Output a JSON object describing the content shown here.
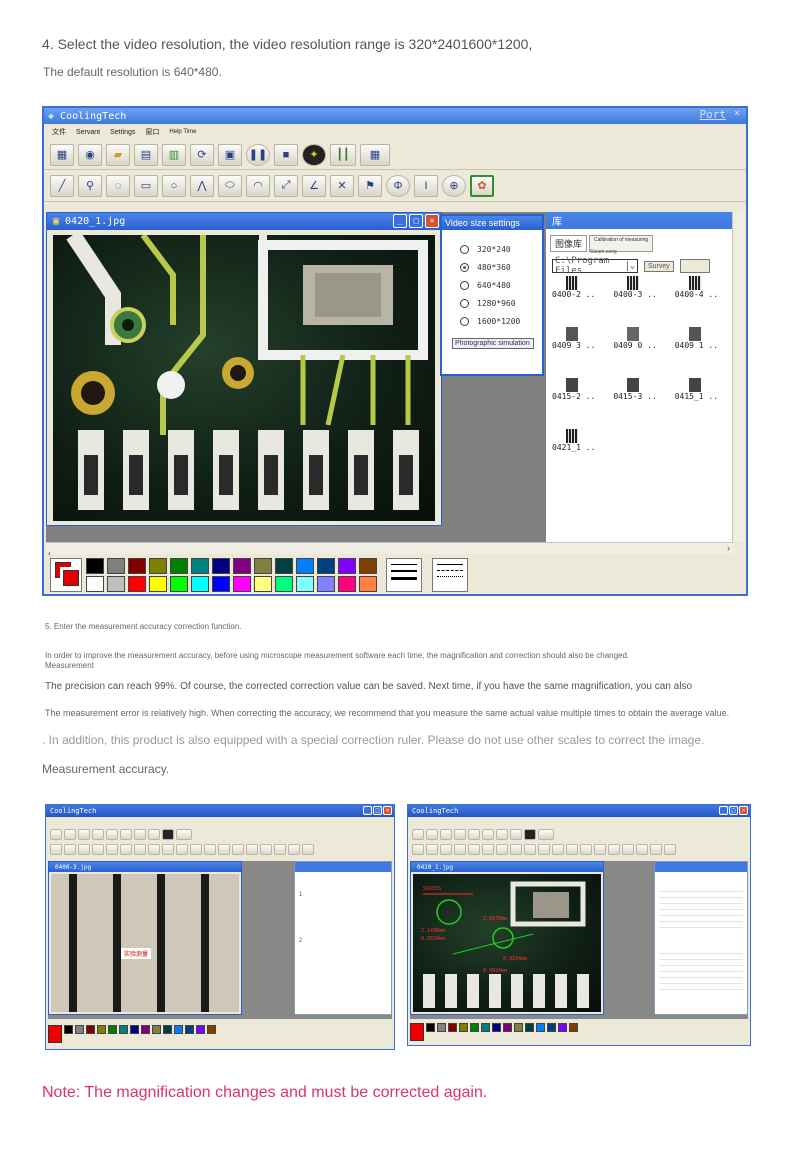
{
  "step4": {
    "title": "4. Select the video resolution, the video resolution range is 320*2401600*1200,",
    "subtitle": "The default resolution is 640*480."
  },
  "app": {
    "title": "CoolingTech",
    "port_label": "Port",
    "menu": [
      "文件",
      "Servant",
      "Settings",
      "窗口",
      "Help Time"
    ],
    "image_window_title": "0420_1.jpg",
    "library_title": "库",
    "library_tabs": [
      "图像库",
      "Calibration of measuring",
      "Steam song"
    ],
    "path_value": "C:\\Program Files",
    "survey_button": "Survey",
    "thumbnails": [
      [
        "0400-2 ..",
        "0400-3 ..",
        "0400-4 .."
      ],
      [
        "0409 3 ..",
        "0409 0 ..",
        "0409 1 .."
      ],
      [
        "0415-2 ..",
        "0415-3 ..",
        "0415_1 .."
      ],
      [
        "0421_1 .."
      ]
    ]
  },
  "video_dialog": {
    "title": "Video size settings",
    "options": [
      "320*240",
      "480*360",
      "640*480",
      "1280*960",
      "1600*1200"
    ],
    "selected_index": 1,
    "footer": "Photographic simulation"
  },
  "palette": {
    "row1": [
      "#e00000",
      "#ffffff",
      "#000000",
      "#808080",
      "#800000",
      "#808000",
      "#008000",
      "#008080",
      "#000080",
      "#800080",
      "#808040",
      "#004040",
      "#0080ff",
      "#004080",
      "#8000ff",
      "#804000"
    ],
    "row2": [
      "#ffffff",
      "#c0c0c0",
      "#ff0000",
      "#ffff00",
      "#00ff00",
      "#00ffff",
      "#0000ff",
      "#ff00ff",
      "#ffff80",
      "#00ff80",
      "#80ffff",
      "#8080ff",
      "#ff0080",
      "#ff8040"
    ]
  },
  "step5": {
    "title": "5. Enter the measurement accuracy correction function.",
    "line1": "In order to improve the measurement accuracy, before using microscope measurement software each time, the magnification and correction should also be changed.",
    "line1b": "Measurement",
    "line2": "The precision can reach 99%. Of course, the corrected correction value can be saved. Next time, if you have the same magnification, you can also",
    "line3": "The measurement error is relatively high. When correcting the accuracy, we recommend that you measure the same actual value multiple times to obtain the average value.",
    "line4": ". In addition, this product is also equipped with a special correction ruler. Please do not use other scales to correct the image.",
    "line5": "Measurement accuracy."
  },
  "screenshot_left": {
    "title": "CoolingTech",
    "image_title": "0400-3.jpg",
    "calibration_label": "实验测量",
    "table_rows": [
      "1",
      "2"
    ]
  },
  "screenshot_right": {
    "title": "CoolingTech",
    "image_title": "0420_1.jpg",
    "labels": [
      "SSSSSS",
      "2.8878mm",
      "2.1438mm",
      "0.9534mm",
      "0.9234mm",
      "0.8924mm"
    ]
  },
  "note": "Note: The magnification changes and must be corrected again."
}
